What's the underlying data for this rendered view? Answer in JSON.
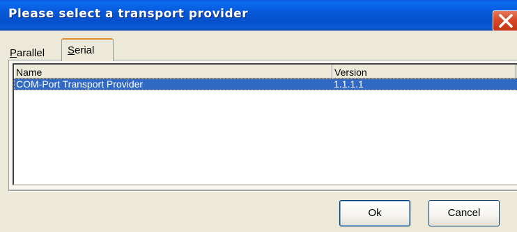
{
  "window": {
    "title": "Please select a transport provider",
    "close_icon": "close-icon"
  },
  "tabs": [
    {
      "label": "Parallel",
      "selected": false
    },
    {
      "label": "Serial",
      "selected": true
    }
  ],
  "list": {
    "columns": [
      "Name",
      "Version"
    ],
    "rows": [
      {
        "name": "COM-Port Transport Provider",
        "version": "1.1.1.1",
        "selected": true
      }
    ]
  },
  "buttons": {
    "ok_label": "Ok",
    "cancel_label": "Cancel"
  },
  "colors": {
    "titlebar": "#0650cc",
    "selection": "#316ac5",
    "window_bg": "#ece9d8",
    "close_button": "#d6492a"
  }
}
